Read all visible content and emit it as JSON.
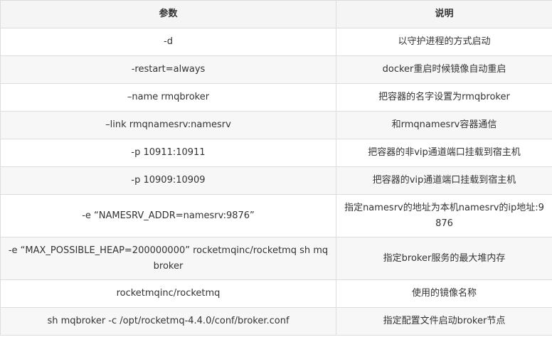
{
  "table": {
    "headers": [
      "参数",
      "说明"
    ],
    "rows": [
      {
        "param": "-d",
        "desc": "以守护进程的方式启动"
      },
      {
        "param": "-restart=always",
        "desc": "docker重启时候镜像自动重启"
      },
      {
        "param": "–name rmqbroker",
        "desc": "把容器的名字设置为rmqbroker"
      },
      {
        "param": "–link rmqnamesrv:namesrv",
        "desc": "和rmqnamesrv容器通信"
      },
      {
        "param": "-p 10911:10911",
        "desc": "把容器的非vip通道端口挂载到宿主机"
      },
      {
        "param": "-p 10909:10909",
        "desc": "把容器的vip通道端口挂载到宿主机"
      },
      {
        "param": "-e “NAMESRV_ADDR=namesrv:9876”",
        "desc": "指定namesrv的地址为本机namesrv的ip地址:9876"
      },
      {
        "param": "-e “MAX_POSSIBLE_HEAP=200000000” rocketmqinc/rocketmq sh mqbroker",
        "desc": "指定broker服务的最大堆内存"
      },
      {
        "param": "rocketmqinc/rocketmq",
        "desc": "使用的镜像名称"
      },
      {
        "param": "sh mqbroker -c /opt/rocketmq-4.4.0/conf/broker.conf",
        "desc": "指定配置文件启动broker节点"
      }
    ]
  }
}
